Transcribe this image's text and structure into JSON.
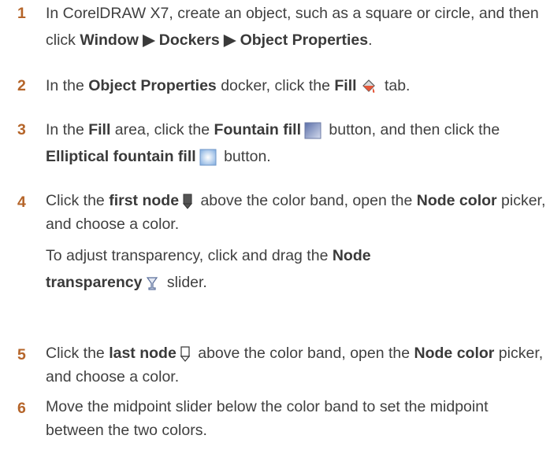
{
  "steps": [
    {
      "num": "1",
      "t1": "In CorelDRAW X7, create an object, such as a square or circle, and then click ",
      "b1": "Window",
      "sep1": " ▶ ",
      "b2": "Dockers",
      "sep2": " ▶ ",
      "b3": "Object Properties",
      "t2": "."
    },
    {
      "num": "2",
      "t1": "In the ",
      "b1": "Object Properties",
      "t2": " docker, click the ",
      "b2": "Fill",
      "t3": " tab."
    },
    {
      "num": "3",
      "t1": "In the ",
      "b1": "Fill",
      "t2": " area, click the ",
      "b2": "Fountain fill",
      "t3": " button, and then click the ",
      "b3": "Elliptical fountain fill",
      "t4": " button."
    },
    {
      "num": "4",
      "t1": "Click the ",
      "b1": "first node",
      "t2": " above the color band, open the ",
      "b2": "Node color",
      "t3": " picker, and choose a color.",
      "s1": "To adjust transparency, click and drag the ",
      "s2": "Node transparency",
      "s3": " slider."
    },
    {
      "num": "5",
      "t1": "Click the ",
      "b1": "last node",
      "t2": " above the color band, open the ",
      "b2": "Node color",
      "t3": " picker, and choose a color."
    },
    {
      "num": "6",
      "t1": "Move the midpoint slider below the color band to set the midpoint between the two colors."
    }
  ],
  "icons": {
    "fill_tab": "paint-bucket-icon",
    "fountain_fill": "fountain-fill-icon",
    "elliptical_fountain_fill": "elliptical-fountain-fill-icon",
    "first_node": "first-node-icon",
    "node_transparency": "node-transparency-icon",
    "last_node": "last-node-icon"
  },
  "colors": {
    "step_number": "#b5652a",
    "text": "#404040"
  }
}
